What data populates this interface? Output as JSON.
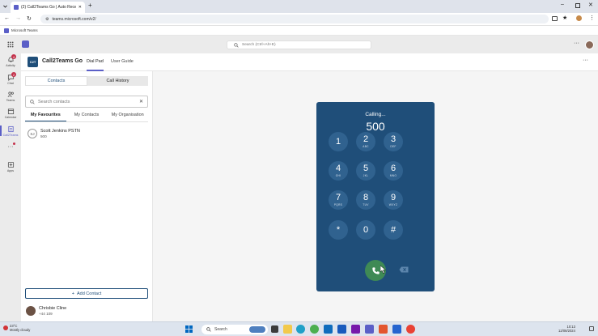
{
  "browser": {
    "tab_title": "(2) Call2Teams Go | Auto Recei...",
    "url": "teams.microsoft.com/v2/",
    "bookmark": "Microsoft Teams"
  },
  "teams": {
    "search_placeholder": "Search (Ctrl+Alt+E)",
    "rail": [
      {
        "label": "Activity",
        "badge": "4"
      },
      {
        "label": "Chat",
        "badge": "2"
      },
      {
        "label": "Teams",
        "badge": ""
      },
      {
        "label": "Calendar",
        "badge": ""
      },
      {
        "label": "Call2Teams",
        "badge": ""
      },
      {
        "label": "",
        "badge": ""
      },
      {
        "label": "Apps",
        "badge": ""
      }
    ]
  },
  "app": {
    "logo_text": "C2T",
    "title": "Call2Teams Go",
    "tabs": [
      "Dial Pad",
      "User Guide"
    ]
  },
  "left_panel": {
    "segments": [
      "Contacts",
      "Call History"
    ],
    "search_placeholder": "Search contacts",
    "subtabs": [
      "My Favourites",
      "My Contacts",
      "My Organisation"
    ],
    "favourites": [
      {
        "initials": "SJ",
        "name": "Scott Jenkins PSTN",
        "number": "500"
      }
    ],
    "add_contact": "Add Contact",
    "user": {
      "name": "Chrisbie Cline",
      "number": "+44 109"
    }
  },
  "dialer": {
    "status": "Calling...",
    "number": "500",
    "keys": [
      {
        "d": "1",
        "l": ""
      },
      {
        "d": "2",
        "l": "ABC"
      },
      {
        "d": "3",
        "l": "DEF"
      },
      {
        "d": "4",
        "l": "GHI"
      },
      {
        "d": "5",
        "l": "JKL"
      },
      {
        "d": "6",
        "l": "MNO"
      },
      {
        "d": "7",
        "l": "PQRS"
      },
      {
        "d": "8",
        "l": "TUV"
      },
      {
        "d": "9",
        "l": "WXYZ"
      },
      {
        "d": "*",
        "l": ""
      },
      {
        "d": "0",
        "l": ""
      },
      {
        "d": "#",
        "l": ""
      }
    ],
    "accent": "#1f4e79",
    "call_color": "#3f8a55"
  },
  "taskbar": {
    "temp": "23°C",
    "weather": "Mostly cloudy",
    "search": "Search",
    "time": "10:13",
    "date": "12/08/2024"
  }
}
